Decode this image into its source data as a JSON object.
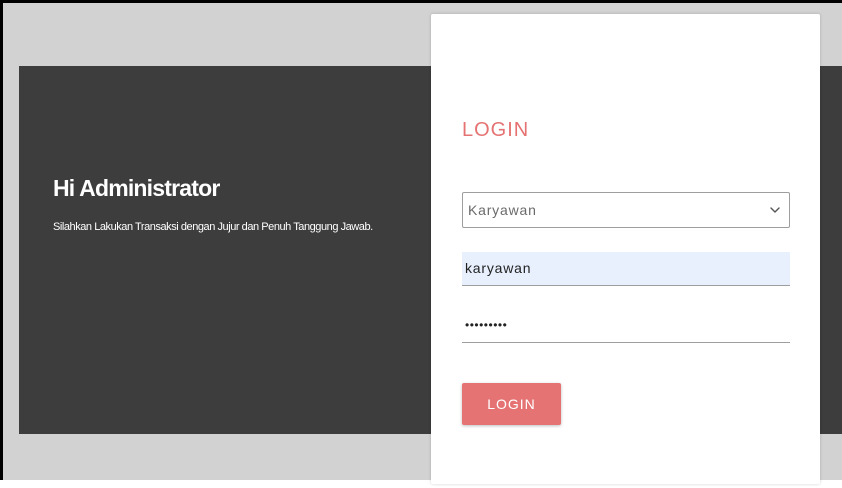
{
  "hero": {
    "greeting": "Hi Administrator",
    "message": "Silahkan Lakukan Transaksi dengan Jujur dan Penuh Tanggung Jawab."
  },
  "login": {
    "title": "LOGIN",
    "role_select": {
      "value": "Karyawan",
      "icon": "chevron-down-icon"
    },
    "username": {
      "value": "karyawan"
    },
    "password": {
      "masked_value": "•••••••••"
    },
    "button_label": "LOGIN"
  },
  "colors": {
    "accent": "#e57373",
    "hero_background": "#3d3d3d",
    "page_background": "#d2d2d2",
    "autofill_background": "#e8f0fe"
  }
}
